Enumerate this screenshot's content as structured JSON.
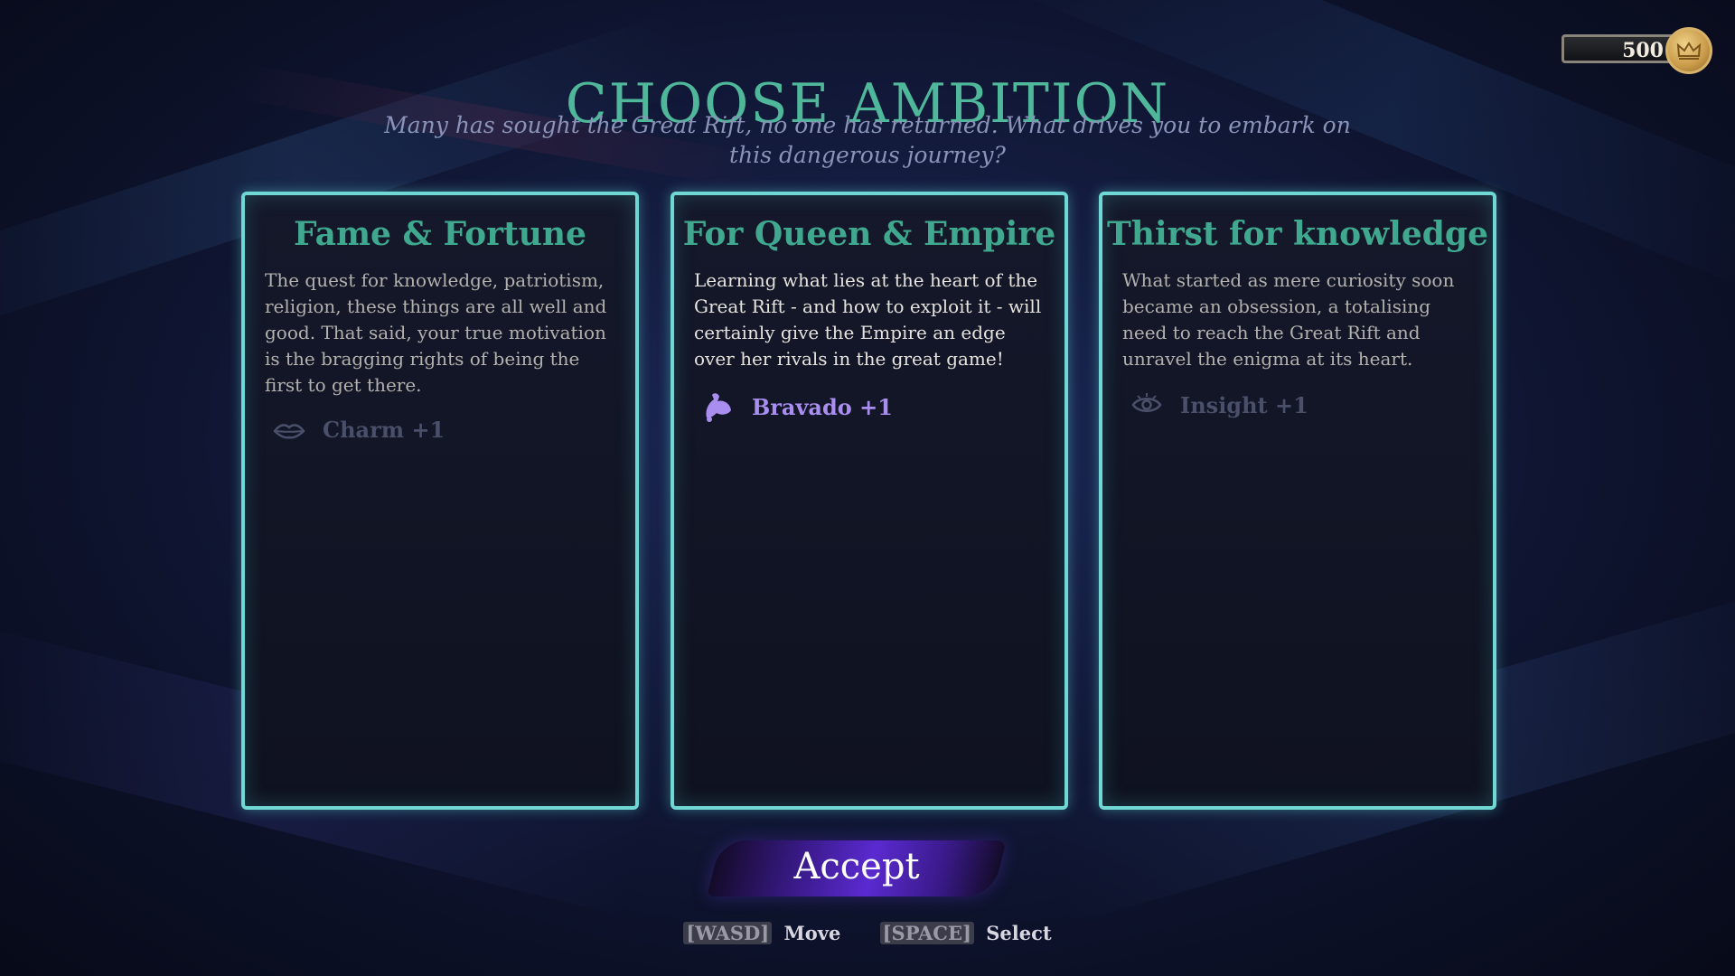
{
  "header": {
    "title": "CHOOSE AMBITION",
    "subtitle": "Many has sought the Great Rift, no one has returned. What drives you to embark on this dangerous journey?"
  },
  "currency": {
    "value": "500",
    "icon": "crown-coin-icon"
  },
  "cards": [
    {
      "title": "Fame & Fortune",
      "description": "The quest for knowledge, patriotism, religion, these things are all well and good. That said, your true motivation is the bragging rights of being the first to get there.",
      "stat_label": "Charm +1",
      "stat_icon": "lips-icon",
      "selected": false
    },
    {
      "title": "For Queen & Empire",
      "description": "Learning what lies at the heart of the Great Rift - and how to exploit it - will certainly give the Empire an edge over her rivals in the great game!",
      "stat_label": "Bravado +1",
      "stat_icon": "bicep-icon",
      "selected": true
    },
    {
      "title": "Thirst for knowledge",
      "description": "What started as mere curiosity soon became an obsession, a totalising need to reach the Great Rift and unravel the enigma at its heart.",
      "stat_label": "Insight +1",
      "stat_icon": "eye-icon",
      "selected": false
    }
  ],
  "accept_button": {
    "label": "Accept"
  },
  "hints": [
    {
      "key": "[WASD]",
      "action": "Move"
    },
    {
      "key": "[SPACE]",
      "action": "Select"
    }
  ],
  "colors": {
    "title": "#4fb79a",
    "card_border": "#6fd8d4",
    "stat_active": "#a98ef0",
    "accept": "#5a2ad0"
  }
}
